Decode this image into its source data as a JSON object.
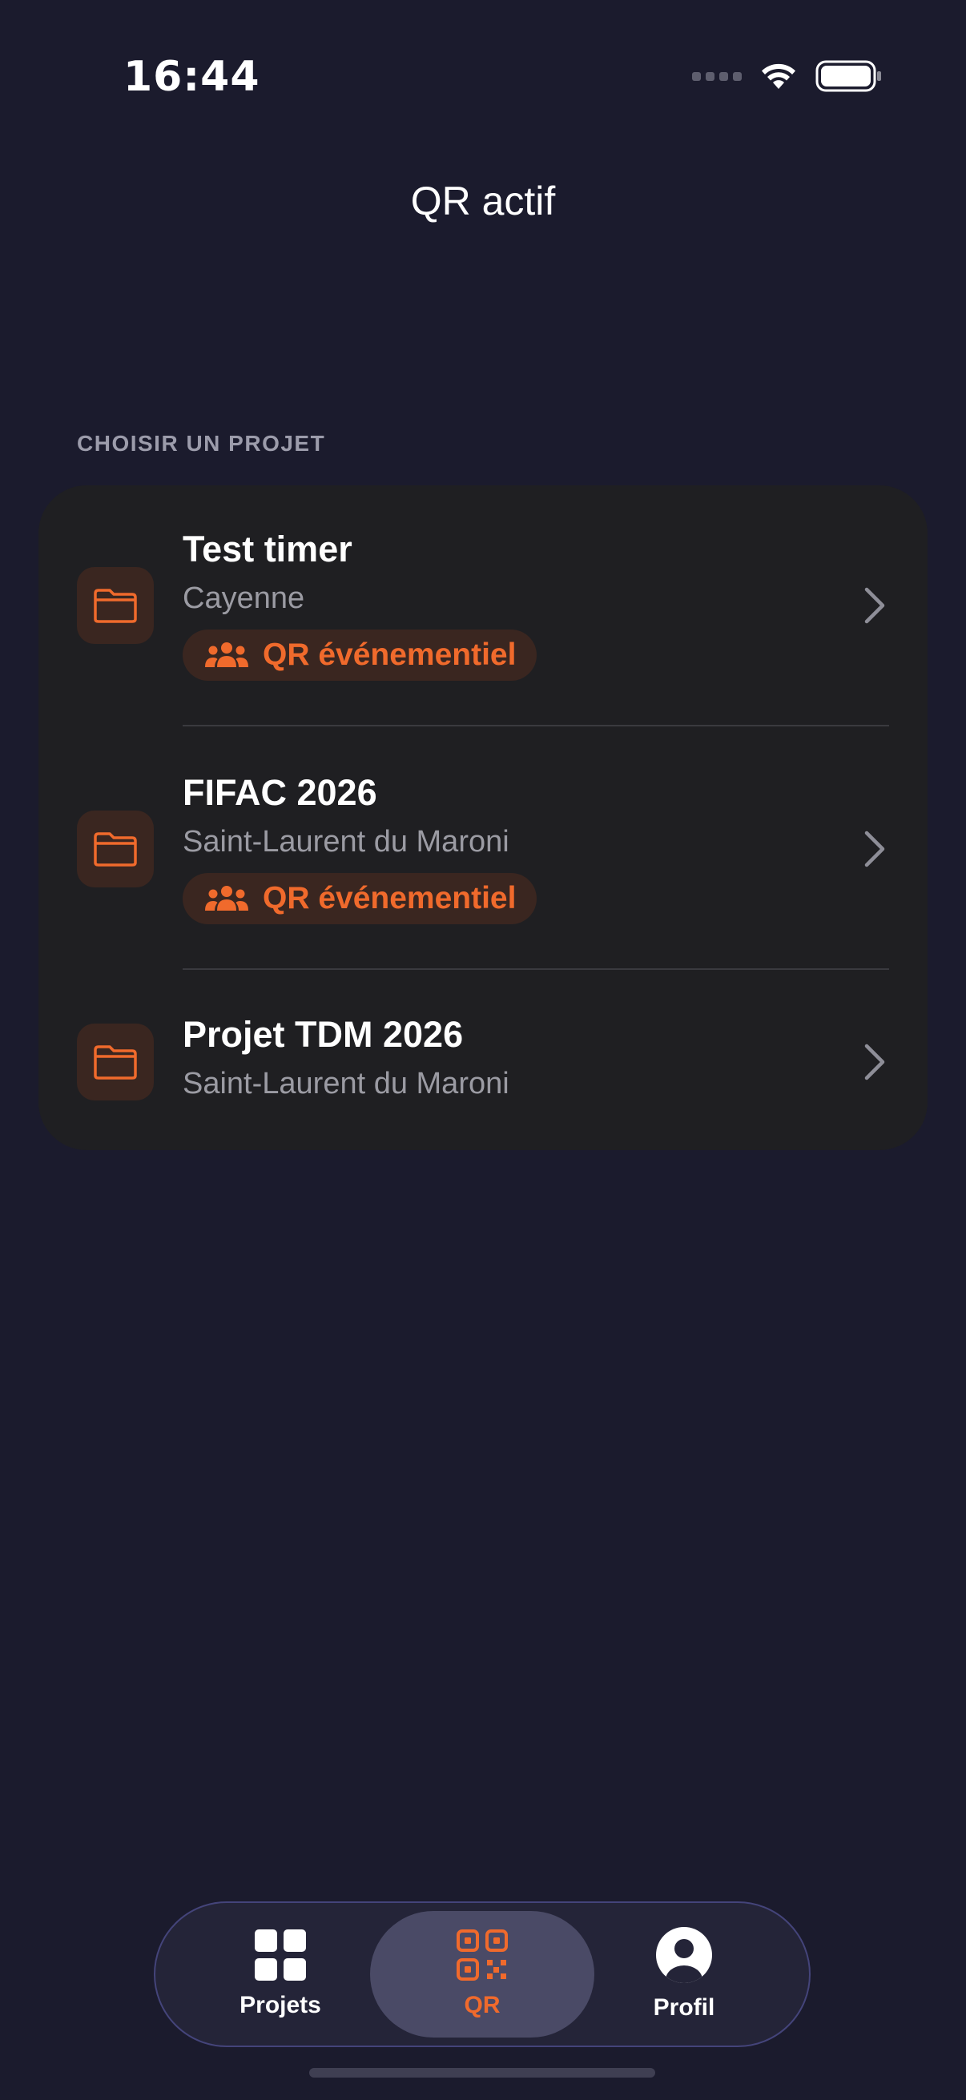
{
  "status_bar": {
    "time": "16:44"
  },
  "header": {
    "title": "QR actif"
  },
  "section": {
    "label": "CHOISIR UN PROJET"
  },
  "projects": [
    {
      "title": "Test timer",
      "location": "Cayenne",
      "badge": "QR événementiel",
      "icon": "folder-icon"
    },
    {
      "title": "FIFAC 2026",
      "location": "Saint-Laurent du Maroni",
      "badge": "QR événementiel",
      "icon": "folder-icon"
    },
    {
      "title": "Projet TDM 2026",
      "location": "Saint-Laurent du Maroni",
      "icon": "folder-icon"
    }
  ],
  "tab_bar": {
    "tabs": [
      {
        "label": "Projets",
        "icon": "grid-icon",
        "active": false
      },
      {
        "label": "QR",
        "icon": "qr-code-icon",
        "active": true
      },
      {
        "label": "Profil",
        "icon": "person-circle-icon",
        "active": false
      }
    ]
  },
  "colors": {
    "background": "#1b1b2d",
    "card": "#1f1f22",
    "accent": "#f06a2c",
    "secondary_text": "#9b9ba3",
    "tab_bar": "#242438",
    "tab_active": "#4a4a66"
  }
}
